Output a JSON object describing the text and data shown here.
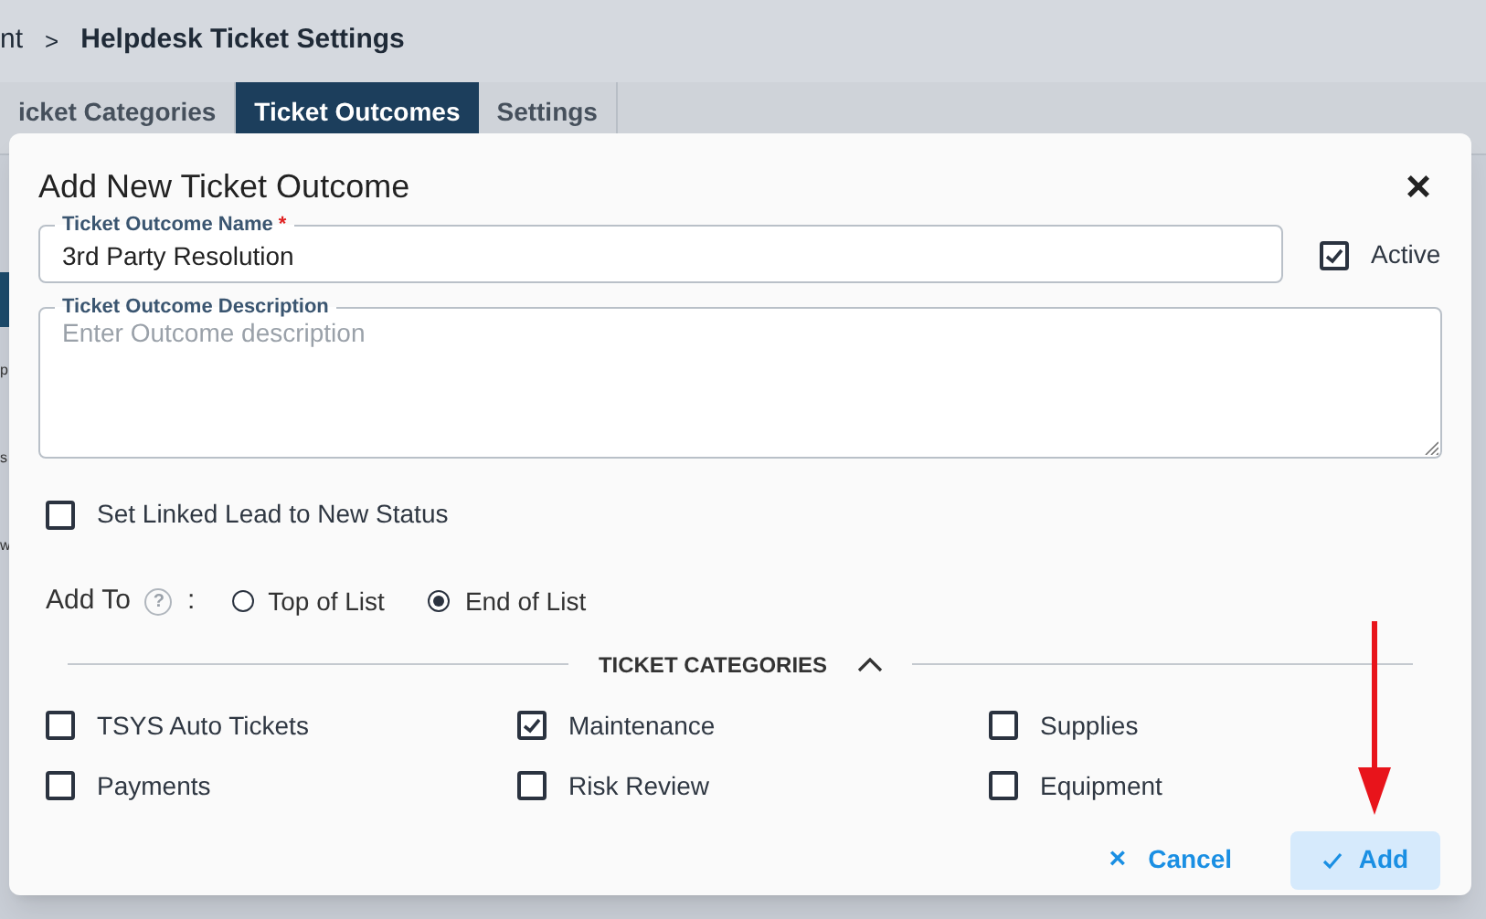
{
  "breadcrumb": {
    "previous": "nt",
    "separator": ">",
    "current": "Helpdesk Ticket Settings"
  },
  "tabs": [
    {
      "label": "icket Categories",
      "selected": false
    },
    {
      "label": "Ticket Outcomes",
      "selected": true
    },
    {
      "label": "Settings",
      "selected": false
    }
  ],
  "background_rows": [
    "p",
    "s",
    "w"
  ],
  "dialog": {
    "title": "Add New Ticket Outcome",
    "close": "×",
    "name_field": {
      "label": "Ticket Outcome Name",
      "required_mark": "*",
      "value": "3rd Party Resolution"
    },
    "active": {
      "label": "Active",
      "checked": true
    },
    "description_field": {
      "label": "Ticket Outcome Description",
      "placeholder": "Enter Outcome description"
    },
    "linked_lead": {
      "label": "Set Linked Lead to New Status",
      "checked": false
    },
    "add_to": {
      "label": "Add To",
      "help": "?",
      "colon": ":",
      "options": [
        {
          "label": "Top of List",
          "selected": false
        },
        {
          "label": "End of List",
          "selected": true
        }
      ]
    },
    "categories_section": {
      "title": "TICKET CATEGORIES",
      "expanded": true,
      "items": [
        {
          "label": "TSYS Auto Tickets",
          "checked": false
        },
        {
          "label": "Maintenance",
          "checked": true
        },
        {
          "label": "Supplies",
          "checked": false
        },
        {
          "label": "Payments",
          "checked": false
        },
        {
          "label": "Risk Review",
          "checked": false
        },
        {
          "label": "Equipment",
          "checked": false
        }
      ]
    },
    "buttons": [
      {
        "kind": "cancel",
        "label": "Cancel",
        "icon": "×"
      },
      {
        "kind": "add",
        "label": "Add"
      }
    ]
  }
}
